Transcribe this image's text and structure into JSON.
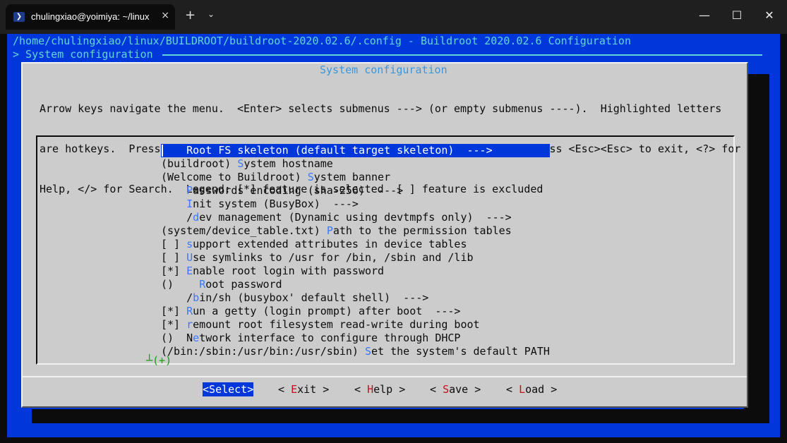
{
  "window": {
    "tab_icon": "powershell-icon",
    "tab_title": "chulingxiao@yoimiya: ~/linux",
    "tab_close_glyph": "×",
    "new_tab_glyph": "+",
    "dropdown_glyph": "⌄",
    "minimize_glyph": "—",
    "maximize_glyph": "☐",
    "close_glyph": "✕"
  },
  "header": {
    "line1": "/home/chulingxiao/linux/BUILDROOT/buildroot-2020.02.6/.config - Buildroot 2020.02.6 Configuration",
    "line2": "> System configuration"
  },
  "dialog": {
    "title": "System configuration",
    "help_lines": [
      "Arrow keys navigate the menu.  <Enter> selects submenus ---> (or empty submenus ----).  Highlighted letters",
      "are hotkeys.  Pressing <Y> selects a feature, while <N> excludes a feature.  Press <Esc><Esc> to exit, <?> for",
      "Help, </> for Search.  Legend: [*] feature is selected  [ ] feature is excluded"
    ]
  },
  "menu": {
    "items": [
      {
        "pre": "    ",
        "hot": "R",
        "post": "oot FS skeleton (default target skeleton)  --->",
        "selected": true
      },
      {
        "pre": "(buildroot) ",
        "hot": "S",
        "post": "ystem hostname"
      },
      {
        "pre": "(Welcome to Buildroot) ",
        "hot": "S",
        "post": "ystem banner"
      },
      {
        "pre": "    ",
        "hot": "P",
        "post": "asswords encoding (sha-256)  --->"
      },
      {
        "pre": "    ",
        "hot": "I",
        "post": "nit system (BusyBox)  --->"
      },
      {
        "pre": "    /",
        "hot": "d",
        "post": "ev management (Dynamic using devtmpfs only)  --->"
      },
      {
        "pre": "(system/device_table.txt) ",
        "hot": "P",
        "post": "ath to the permission tables"
      },
      {
        "pre": "[ ] ",
        "hot": "s",
        "post": "upport extended attributes in device tables"
      },
      {
        "pre": "[ ] ",
        "hot": "U",
        "post": "se symlinks to /usr for /bin, /sbin and /lib"
      },
      {
        "pre": "[*] ",
        "hot": "E",
        "post": "nable root login with password"
      },
      {
        "pre": "()    ",
        "hot": "R",
        "post": "oot password"
      },
      {
        "pre": "    /",
        "hot": "b",
        "post": "in/sh (busybox' default shell)  --->"
      },
      {
        "pre": "[*] ",
        "hot": "R",
        "post": "un a getty (login prompt) after boot  --->"
      },
      {
        "pre": "[*] ",
        "hot": "r",
        "post": "emount root filesystem read-write during boot"
      },
      {
        "pre": "()  N",
        "hot": "e",
        "post": "twork interface to configure through DHCP"
      },
      {
        "pre": "(/bin:/sbin:/usr/bin:/usr/sbin) ",
        "hot": "S",
        "post": "et the system's default PATH"
      }
    ],
    "more_indicator": "┴(+)"
  },
  "buttons": [
    {
      "pre": "<",
      "key": "S",
      "post": "elect>",
      "active": true
    },
    {
      "pre": "< ",
      "key": "E",
      "post": "xit >"
    },
    {
      "pre": "< ",
      "key": "H",
      "post": "elp >"
    },
    {
      "pre": "< ",
      "key": "S",
      "post": "ave >"
    },
    {
      "pre": "< ",
      "key": "L",
      "post": "oad >"
    }
  ],
  "colors": {
    "background_blue": "#0037da",
    "dialog_gray": "#cccccc",
    "hotkey_blue": "#3b78ff",
    "button_key_red": "#c50f1f",
    "header_cyan": "#61d6d6",
    "more_green": "#13a10e"
  }
}
